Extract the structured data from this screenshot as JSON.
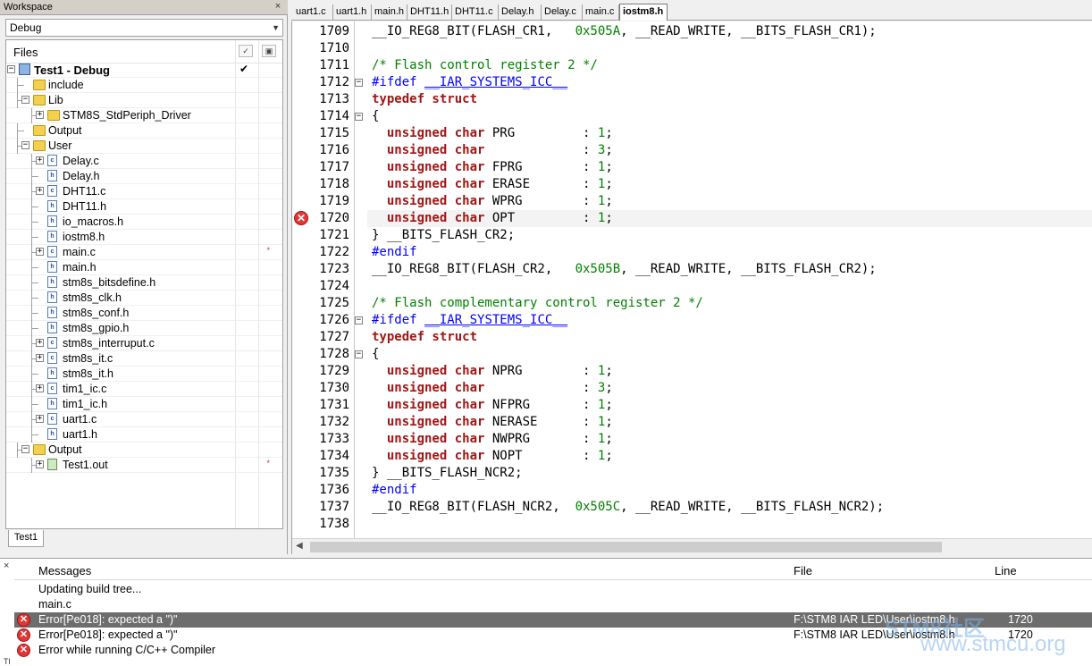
{
  "workspace": {
    "title": "Workspace",
    "close": "×",
    "config": "Debug",
    "files_header": "Files",
    "bottom_tab": "Test1",
    "items": [
      {
        "label": "Test1 - Debug",
        "depth": 0,
        "kind": "project",
        "expand": "−",
        "check": "✔"
      },
      {
        "label": "include",
        "depth": 1,
        "kind": "folder",
        "expand": ""
      },
      {
        "label": "Lib",
        "depth": 1,
        "kind": "folder",
        "expand": "−"
      },
      {
        "label": "STM8S_StdPeriph_Driver",
        "depth": 2,
        "kind": "folder",
        "expand": "+"
      },
      {
        "label": "Output",
        "depth": 1,
        "kind": "folder",
        "expand": ""
      },
      {
        "label": "User",
        "depth": 1,
        "kind": "folder",
        "expand": "−"
      },
      {
        "label": "Delay.c",
        "depth": 2,
        "kind": "c",
        "expand": "+"
      },
      {
        "label": "Delay.h",
        "depth": 2,
        "kind": "h",
        "expand": ""
      },
      {
        "label": "DHT11.c",
        "depth": 2,
        "kind": "c",
        "expand": "+"
      },
      {
        "label": "DHT11.h",
        "depth": 2,
        "kind": "h",
        "expand": ""
      },
      {
        "label": "io_macros.h",
        "depth": 2,
        "kind": "h",
        "expand": ""
      },
      {
        "label": "iostm8.h",
        "depth": 2,
        "kind": "h",
        "expand": ""
      },
      {
        "label": "main.c",
        "depth": 2,
        "kind": "c",
        "expand": "+",
        "mark": "*"
      },
      {
        "label": "main.h",
        "depth": 2,
        "kind": "h",
        "expand": ""
      },
      {
        "label": "stm8s_bitsdefine.h",
        "depth": 2,
        "kind": "h",
        "expand": ""
      },
      {
        "label": "stm8s_clk.h",
        "depth": 2,
        "kind": "h",
        "expand": ""
      },
      {
        "label": "stm8s_conf.h",
        "depth": 2,
        "kind": "h",
        "expand": ""
      },
      {
        "label": "stm8s_gpio.h",
        "depth": 2,
        "kind": "h",
        "expand": ""
      },
      {
        "label": "stm8s_interruput.c",
        "depth": 2,
        "kind": "c",
        "expand": "+"
      },
      {
        "label": "stm8s_it.c",
        "depth": 2,
        "kind": "c",
        "expand": "+"
      },
      {
        "label": "stm8s_it.h",
        "depth": 2,
        "kind": "h",
        "expand": ""
      },
      {
        "label": "tim1_ic.c",
        "depth": 2,
        "kind": "c",
        "expand": "+"
      },
      {
        "label": "tim1_ic.h",
        "depth": 2,
        "kind": "h",
        "expand": ""
      },
      {
        "label": "uart1.c",
        "depth": 2,
        "kind": "c",
        "expand": "+"
      },
      {
        "label": "uart1.h",
        "depth": 2,
        "kind": "h",
        "expand": ""
      },
      {
        "label": "Output",
        "depth": 1,
        "kind": "folder",
        "expand": "−"
      },
      {
        "label": "Test1.out",
        "depth": 2,
        "kind": "out",
        "expand": "+",
        "mark": "*"
      }
    ]
  },
  "editor": {
    "tabs": [
      "uart1.c",
      "uart1.h",
      "main.h",
      "DHT11.h",
      "DHT11.c",
      "Delay.h",
      "Delay.c",
      "main.c",
      "iostm8.h"
    ],
    "active_tab": "iostm8.h",
    "lines": [
      {
        "no": "1709",
        "parts": [
          [
            "",
            "__IO_REG8_BIT(FLASH_CR1,   "
          ],
          [
            "num",
            "0x505A"
          ],
          [
            "",
            ", __READ_WRITE, __BITS_FLASH_CR1);"
          ]
        ]
      },
      {
        "no": "1710",
        "parts": []
      },
      {
        "no": "1711",
        "parts": [
          [
            "cm",
            "/* Flash control register 2 */"
          ]
        ]
      },
      {
        "no": "1712",
        "fold": "−",
        "parts": [
          [
            "pp",
            "#ifdef "
          ],
          [
            "mac",
            "__IAR_SYSTEMS_ICC__"
          ]
        ]
      },
      {
        "no": "1713",
        "parts": [
          [
            "kw",
            "typedef struct"
          ]
        ]
      },
      {
        "no": "1714",
        "fold": "−",
        "parts": [
          [
            "",
            "{"
          ]
        ]
      },
      {
        "no": "1715",
        "parts": [
          [
            "kw",
            "  unsigned char "
          ],
          [
            "",
            "PRG         : "
          ],
          [
            "num",
            "1"
          ],
          [
            "",
            ";"
          ]
        ]
      },
      {
        "no": "1716",
        "parts": [
          [
            "kw",
            "  unsigned char "
          ],
          [
            "",
            "            : "
          ],
          [
            "num",
            "3"
          ],
          [
            "",
            ";"
          ]
        ]
      },
      {
        "no": "1717",
        "parts": [
          [
            "kw",
            "  unsigned char "
          ],
          [
            "",
            "FPRG        : "
          ],
          [
            "num",
            "1"
          ],
          [
            "",
            ";"
          ]
        ]
      },
      {
        "no": "1718",
        "parts": [
          [
            "kw",
            "  unsigned char "
          ],
          [
            "",
            "ERASE       : "
          ],
          [
            "num",
            "1"
          ],
          [
            "",
            ";"
          ]
        ]
      },
      {
        "no": "1719",
        "parts": [
          [
            "kw",
            "  unsigned char "
          ],
          [
            "",
            "WPRG        : "
          ],
          [
            "num",
            "1"
          ],
          [
            "",
            ";"
          ]
        ]
      },
      {
        "no": "1720",
        "error": true,
        "current": true,
        "parts": [
          [
            "kw",
            "  unsigned char "
          ],
          [
            "",
            "OPT         : "
          ],
          [
            "num",
            "1"
          ],
          [
            "",
            ";"
          ]
        ]
      },
      {
        "no": "1721",
        "parts": [
          [
            "",
            "} __BITS_FLASH_CR2;"
          ]
        ]
      },
      {
        "no": "1722",
        "parts": [
          [
            "pp",
            "#endif"
          ]
        ]
      },
      {
        "no": "1723",
        "parts": [
          [
            "",
            "__IO_REG8_BIT(FLASH_CR2,   "
          ],
          [
            "num",
            "0x505B"
          ],
          [
            "",
            ", __READ_WRITE, __BITS_FLASH_CR2);"
          ]
        ]
      },
      {
        "no": "1724",
        "parts": []
      },
      {
        "no": "1725",
        "parts": [
          [
            "cm",
            "/* Flash complementary control register 2 */"
          ]
        ]
      },
      {
        "no": "1726",
        "fold": "−",
        "parts": [
          [
            "pp",
            "#ifdef "
          ],
          [
            "mac",
            "__IAR_SYSTEMS_ICC__"
          ]
        ]
      },
      {
        "no": "1727",
        "parts": [
          [
            "kw",
            "typedef struct"
          ]
        ]
      },
      {
        "no": "1728",
        "fold": "−",
        "parts": [
          [
            "",
            "{"
          ]
        ]
      },
      {
        "no": "1729",
        "parts": [
          [
            "kw",
            "  unsigned char "
          ],
          [
            "",
            "NPRG        : "
          ],
          [
            "num",
            "1"
          ],
          [
            "",
            ";"
          ]
        ]
      },
      {
        "no": "1730",
        "parts": [
          [
            "kw",
            "  unsigned char "
          ],
          [
            "",
            "            : "
          ],
          [
            "num",
            "3"
          ],
          [
            "",
            ";"
          ]
        ]
      },
      {
        "no": "1731",
        "parts": [
          [
            "kw",
            "  unsigned char "
          ],
          [
            "",
            "NFPRG       : "
          ],
          [
            "num",
            "1"
          ],
          [
            "",
            ";"
          ]
        ]
      },
      {
        "no": "1732",
        "parts": [
          [
            "kw",
            "  unsigned char "
          ],
          [
            "",
            "NERASE      : "
          ],
          [
            "num",
            "1"
          ],
          [
            "",
            ";"
          ]
        ]
      },
      {
        "no": "1733",
        "parts": [
          [
            "kw",
            "  unsigned char "
          ],
          [
            "",
            "NWPRG       : "
          ],
          [
            "num",
            "1"
          ],
          [
            "",
            ";"
          ]
        ]
      },
      {
        "no": "1734",
        "parts": [
          [
            "kw",
            "  unsigned char "
          ],
          [
            "",
            "NOPT        : "
          ],
          [
            "num",
            "1"
          ],
          [
            "",
            ";"
          ]
        ]
      },
      {
        "no": "1735",
        "parts": [
          [
            "",
            "} __BITS_FLASH_NCR2;"
          ]
        ]
      },
      {
        "no": "1736",
        "parts": [
          [
            "pp",
            "#endif"
          ]
        ]
      },
      {
        "no": "1737",
        "parts": [
          [
            "",
            "__IO_REG8_BIT(FLASH_NCR2,  "
          ],
          [
            "num",
            "0x505C"
          ],
          [
            "",
            ", __READ_WRITE, __BITS_FLASH_NCR2);"
          ]
        ]
      },
      {
        "no": "1738",
        "parts": []
      }
    ]
  },
  "messages": {
    "close": "×",
    "col_messages": "Messages",
    "col_file": "File",
    "col_line": "Line",
    "rows": [
      {
        "text": "Updating build tree...",
        "file": "",
        "line": "",
        "error": false
      },
      {
        "text": "main.c",
        "file": "",
        "line": "",
        "error": false
      },
      {
        "text": "Error[Pe018]: expected a \")\"",
        "file": "F:\\STM8 IAR  LED\\User\\iostm8.h",
        "line": "1720",
        "error": true,
        "selected": true
      },
      {
        "text": "Error[Pe018]: expected a \")\"",
        "file": "F:\\STM8 IAR  LED\\User\\iostm8.h",
        "line": "1720",
        "error": true
      },
      {
        "text": "Error while running C/C++ Compiler",
        "file": "",
        "line": "",
        "error": true
      }
    ],
    "watermark_1": "STM8社区",
    "watermark_2": "www.stmcu.org",
    "footer": "Tl"
  },
  "colors": {
    "keyword": "#a31515",
    "comment": "#008000",
    "preprocessor": "#0000ff",
    "error": "#e23636",
    "selection": "#6d6d6d"
  }
}
